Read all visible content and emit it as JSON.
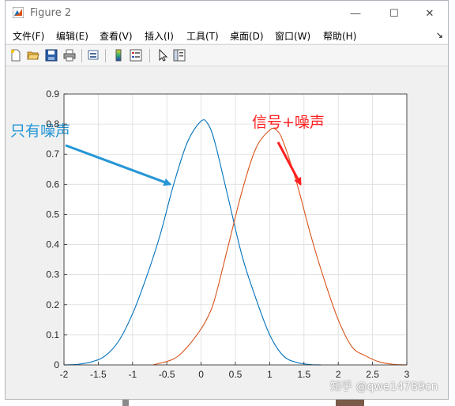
{
  "window": {
    "title": "Figure 2",
    "buttons": {
      "minimize": "—",
      "maximize": "☐",
      "close": "✕"
    }
  },
  "menu": [
    "文件(F)",
    "编辑(E)",
    "查看(V)",
    "插入(I)",
    "工具(T)",
    "桌面(D)",
    "窗口(W)",
    "帮助(H)"
  ],
  "dock_glyph": "↘",
  "toolbar": [
    "new-figure-icon",
    "open-file-icon",
    "save-icon",
    "print-icon",
    "print-preview-icon",
    "colorbar-icon",
    "legend-icon",
    "pointer-icon",
    "property-editor-icon"
  ],
  "watermark": "知乎 @qwe14789cn",
  "colors": {
    "noise": "#0072bd",
    "signal": "#d95319",
    "annotation_red": "#ff2020"
  },
  "chart_data": {
    "type": "line",
    "xlim": [
      -2,
      3
    ],
    "ylim": [
      0,
      0.9
    ],
    "xticks": [
      -2,
      -1.5,
      -1,
      -0.5,
      0,
      0.5,
      1,
      1.5,
      2,
      2.5,
      3
    ],
    "yticks": [
      0,
      0.1,
      0.2,
      0.3,
      0.4,
      0.5,
      0.6,
      0.7,
      0.8,
      0.9
    ],
    "xtick_labels": [
      "-2",
      "-1.5",
      "-1",
      "-0.5",
      "0",
      "0.5",
      "1",
      "1.5",
      "2",
      "2.5",
      "3"
    ],
    "ytick_labels": [
      "0",
      "0.1",
      "0.2",
      "0.3",
      "0.4",
      "0.5",
      "0.6",
      "0.7",
      "0.8",
      "0.9"
    ],
    "grid": true,
    "series": [
      {
        "name": "只有噪声",
        "x": [
          -2.0,
          -1.8,
          -1.6,
          -1.4,
          -1.2,
          -1.0,
          -0.8,
          -0.6,
          -0.4,
          -0.2,
          0.0,
          0.1,
          0.2,
          0.4,
          0.6,
          0.8,
          1.0,
          1.2,
          1.4,
          1.6,
          1.75
        ],
        "y": [
          0.0,
          0.002,
          0.01,
          0.03,
          0.08,
          0.17,
          0.29,
          0.43,
          0.6,
          0.74,
          0.81,
          0.8,
          0.74,
          0.55,
          0.36,
          0.22,
          0.1,
          0.03,
          0.008,
          0.001,
          0.0
        ]
      },
      {
        "name": "信号+噪声",
        "x": [
          -0.7,
          -0.4,
          -0.2,
          0.0,
          0.1,
          0.2,
          0.4,
          0.6,
          0.8,
          1.0,
          1.1,
          1.2,
          1.4,
          1.6,
          1.8,
          2.0,
          2.2,
          2.4,
          2.6,
          2.8,
          3.0
        ],
        "y": [
          0.0,
          0.02,
          0.06,
          0.12,
          0.16,
          0.22,
          0.4,
          0.58,
          0.72,
          0.78,
          0.78,
          0.74,
          0.6,
          0.43,
          0.28,
          0.15,
          0.06,
          0.03,
          0.01,
          0.002,
          0.0
        ]
      }
    ],
    "annotations": [
      {
        "text": "只有噪声",
        "color": "#2596d6",
        "target": [
          -0.45,
          0.6
        ]
      },
      {
        "text": "信号+噪声",
        "color": "#ff2020",
        "target": [
          1.45,
          0.6
        ]
      }
    ]
  }
}
